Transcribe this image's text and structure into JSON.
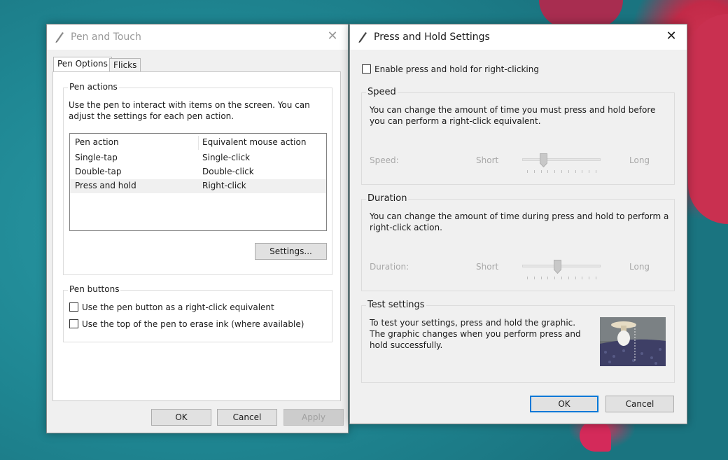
{
  "pen_touch": {
    "title": "Pen and Touch",
    "close_glyph": "✕",
    "tabs": [
      "Pen Options",
      "Flicks"
    ],
    "pen_actions": {
      "group_label": "Pen actions",
      "description": "Use the pen to interact with items on the screen.  You can adjust the settings for each pen action.",
      "columns": [
        "Pen action",
        "Equivalent mouse action"
      ],
      "rows": [
        [
          "Single-tap",
          "Single-click"
        ],
        [
          "Double-tap",
          "Double-click"
        ],
        [
          "Press and hold",
          "Right-click"
        ]
      ],
      "settings_button": "Settings..."
    },
    "pen_buttons": {
      "group_label": "Pen buttons",
      "options": [
        {
          "label": "Use the pen button as a right-click equivalent",
          "checked": false
        },
        {
          "label": "Use the top of the pen to erase ink (where available)",
          "checked": false
        }
      ]
    },
    "buttons": {
      "ok": "OK",
      "cancel": "Cancel",
      "apply": "Apply"
    }
  },
  "press_hold": {
    "title": "Press and Hold Settings",
    "close_glyph": "✕",
    "enable_label": "Enable press and hold for right-clicking",
    "enable_checked": false,
    "speed": {
      "group_label": "Speed",
      "description": "You can change the amount of time you must press and hold before you can perform a right-click equivalent.",
      "label": "Speed:",
      "min": "Short",
      "max": "Long",
      "level": 0.25
    },
    "duration": {
      "group_label": "Duration",
      "description": "You can change the amount of time during press and hold to perform a right-click action.",
      "label": "Duration:",
      "min": "Short",
      "max": "Long",
      "level": 0.45
    },
    "test": {
      "group_label": "Test settings",
      "description": "To test your settings, press and hold the graphic. The graphic changes when you perform press and hold successfully."
    },
    "buttons": {
      "ok": "OK",
      "cancel": "Cancel"
    }
  },
  "icons": [
    "pen-icon",
    "close-icon",
    "checkbox",
    "slider-thumb",
    "test-graphic"
  ]
}
